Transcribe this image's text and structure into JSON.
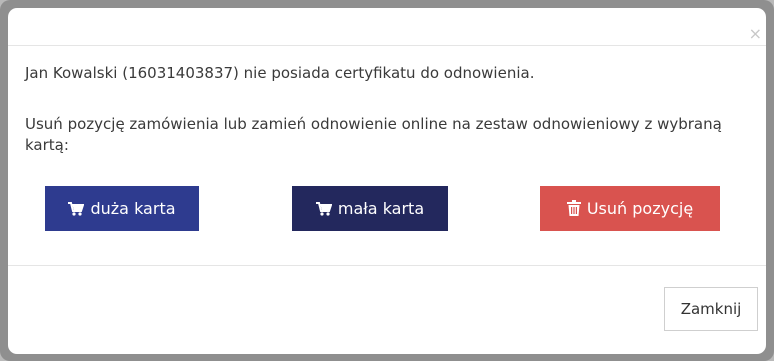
{
  "modal": {
    "close_symbol": "×",
    "message_line1": "Jan Kowalski (16031403837) nie posiada certyfikatu do odnowienia.",
    "message_line2": "Usuń pozycję zamówienia lub zamień odnowienie online na zestaw odnowieniowy z wybraną kartą:",
    "buttons": {
      "big_card": {
        "label": "duża karta",
        "icon": "cart-icon",
        "color": "#2e3b8f"
      },
      "small_card": {
        "label": "mała karta",
        "icon": "cart-icon",
        "color": "#23285d"
      },
      "remove_item": {
        "label": "Usuń pozycję",
        "icon": "trash-icon",
        "color": "#d9534f"
      }
    },
    "footer": {
      "close_label": "Zamknij"
    }
  }
}
